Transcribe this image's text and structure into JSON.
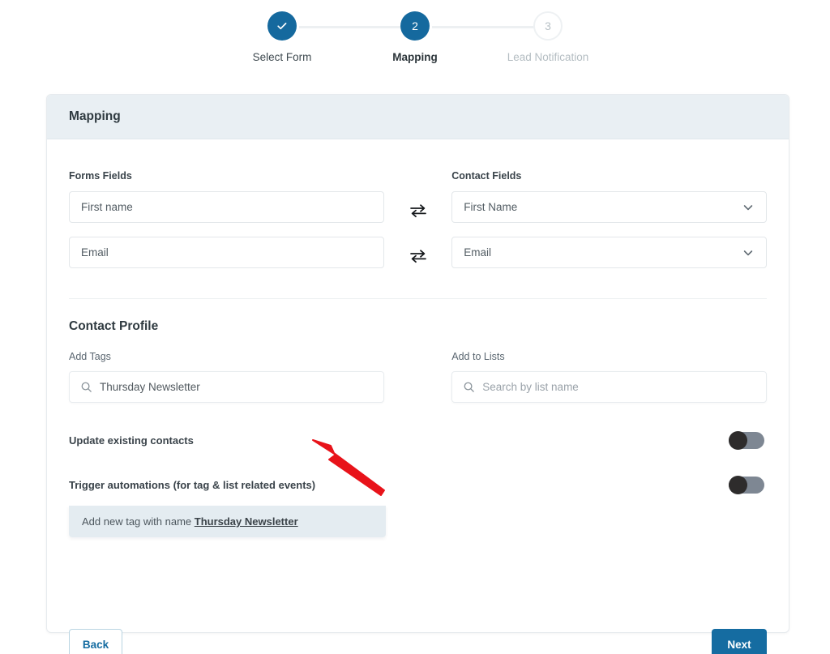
{
  "stepper": {
    "steps": [
      {
        "number": "1",
        "label": "Select Form",
        "state": "done",
        "icon": "check-icon"
      },
      {
        "number": "2",
        "label": "Mapping",
        "state": "active"
      },
      {
        "number": "3",
        "label": "Lead Notification",
        "state": "idle"
      }
    ]
  },
  "card": {
    "header_title": "Mapping",
    "mapping": {
      "left_label": "Forms Fields",
      "right_label": "Contact Fields",
      "swap_icon": "swap-arrows-icon",
      "rows": [
        {
          "form_field": "First name",
          "contact_field": "First Name"
        },
        {
          "form_field": "Email",
          "contact_field": "Email"
        }
      ]
    },
    "contact_profile": {
      "title": "Contact Profile",
      "tags_label": "Add Tags",
      "tags_value": "Thursday Newsletter",
      "tags_search_icon": "search-icon",
      "suggestion_prefix": "Add new tag with name ",
      "suggestion_tag": "Thursday Newsletter",
      "lists_label": "Add to Lists",
      "lists_placeholder": "Search by list name",
      "lists_search_icon": "search-icon"
    },
    "toggles": [
      {
        "label": "Update existing contacts",
        "on": false
      },
      {
        "label": "Trigger automations (for tag & list related events)",
        "on": false
      }
    ],
    "footer": {
      "back_label": "Back",
      "next_label": "Next"
    }
  },
  "annotation": {
    "arrow_color": "#e8131a",
    "arrow_name": "red-pointer-arrow"
  },
  "colors": {
    "accent": "#156ca1",
    "header_bg": "#e9eff3",
    "suggestion_bg": "#e4ecf1",
    "toggle_track": "#7e8793",
    "toggle_knob": "#2e2c2c"
  }
}
